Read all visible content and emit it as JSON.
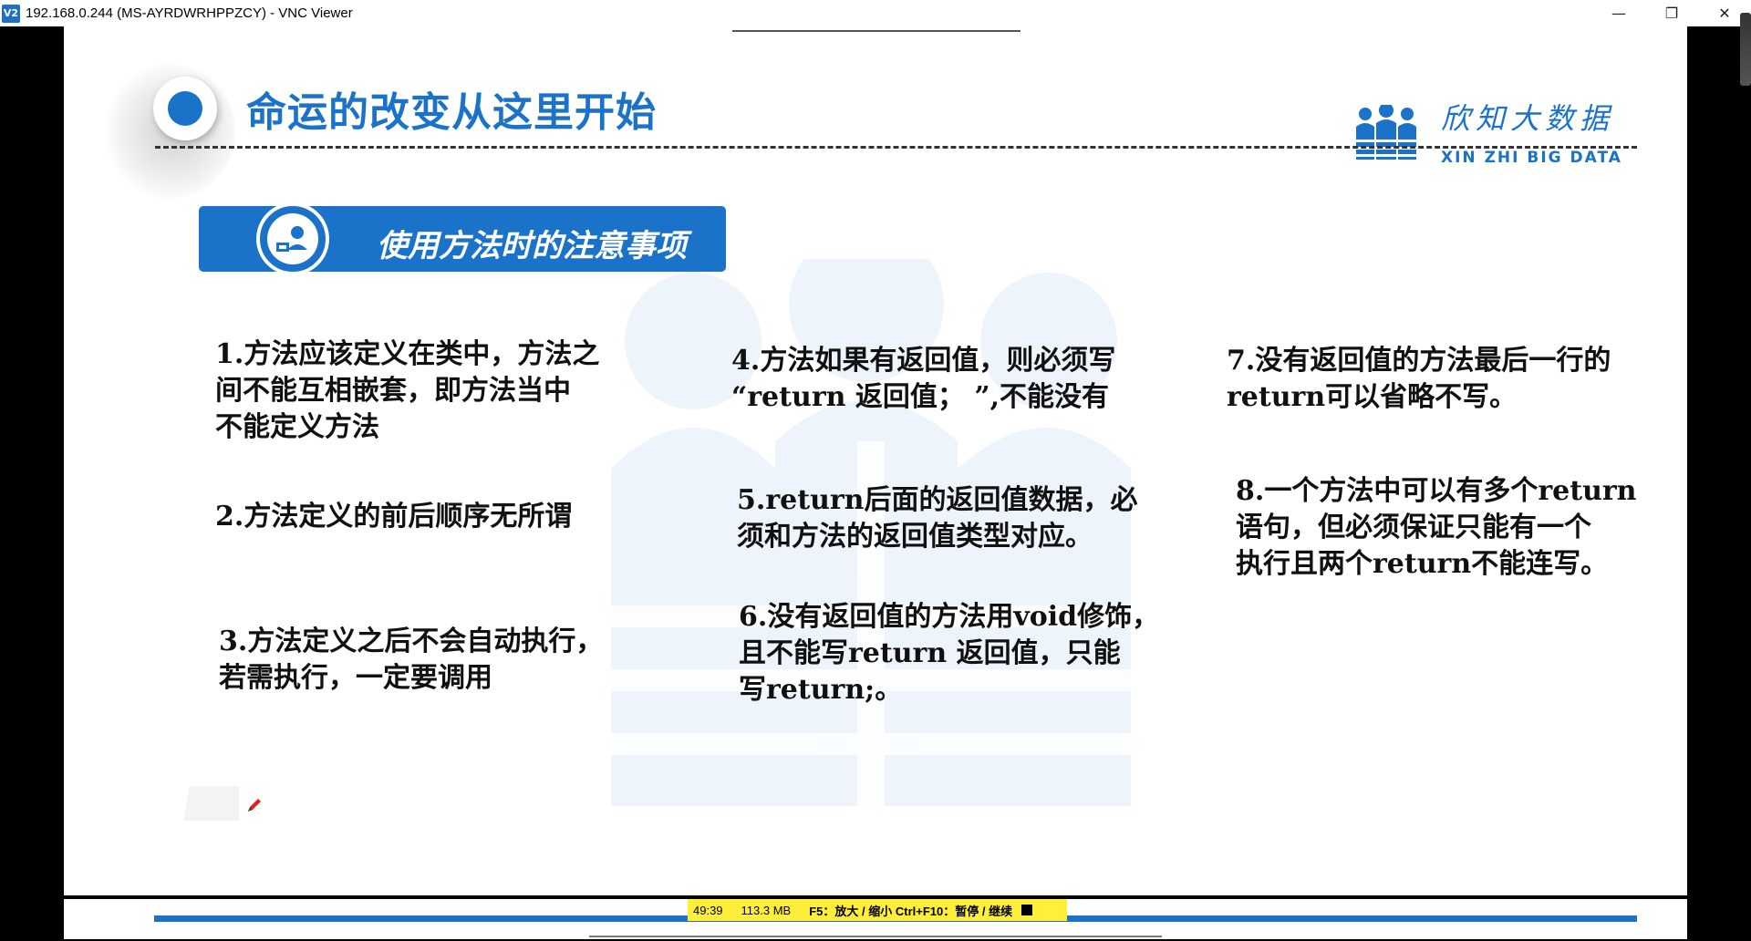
{
  "window": {
    "icon_label": "V2",
    "title": "192.168.0.244 (MS-AYRDWRHPPZCY) - VNC Viewer",
    "minimize": "—",
    "restore": "❐",
    "close": "✕"
  },
  "slide": {
    "title": "命运的改变从这里开始",
    "brand_cn": "欣知大数据",
    "brand_en": "XIN ZHI BIG DATA",
    "section_title": "使用方法时的注意事项",
    "notes": [
      {
        "lines": [
          "1.方法应该定义在类中，方法之",
          "间不能互相嵌套，即方法当中",
          "不能定义方法"
        ]
      },
      {
        "lines": [
          "2.方法定义的前后顺序无所谓"
        ]
      },
      {
        "lines": [
          "3.方法定义之后不会自动执行，",
          "若需执行，一定要调用"
        ]
      },
      {
        "lines": [
          "4.方法如果有返回值，则必须写",
          "“return 返回值； ”,不能没有"
        ]
      },
      {
        "lines": [
          "5.return后面的返回值数据，必",
          "须和方法的返回值类型对应。"
        ]
      },
      {
        "lines": [
          "6.没有返回值的方法用void修饰，",
          "且不能写return 返回值，只能",
          "写return;。"
        ]
      },
      {
        "lines": [
          "7.没有返回值的方法最后一行的",
          "return可以省略不写。"
        ]
      },
      {
        "lines": [
          "8.一个方法中可以有多个return",
          "语句，但必须保证只能有一个",
          "执行且两个return不能连写。"
        ]
      }
    ],
    "colors": {
      "accent": "#1b72c9",
      "watermark": "#eef4fb"
    }
  },
  "status_bar": {
    "time": "49:39",
    "memory": "113.3 MB",
    "hint": "F5：放大 / 缩小 Ctrl+F10：暂停 / 继续",
    "stop_icon": "stop-square-icon"
  }
}
